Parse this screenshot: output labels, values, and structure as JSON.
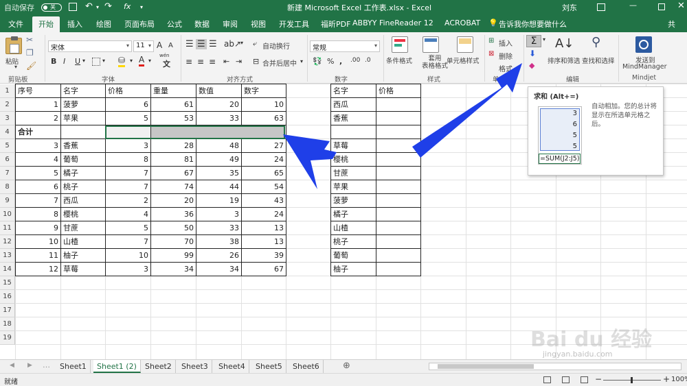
{
  "titlebar": {
    "autosave_label": "自动保存",
    "autosave_state": "关",
    "save_icon": "save-icon",
    "undo_icon": "undo-icon",
    "redo_icon": "redo-icon",
    "fx_label": "fx",
    "title": "新建 Microsoft Excel 工作表.xlsx  -  Excel",
    "user": "刘东",
    "accent": "#217346"
  },
  "tabs": [
    "文件",
    "开始",
    "插入",
    "绘图",
    "页面布局",
    "公式",
    "数据",
    "审阅",
    "视图",
    "开发工具",
    "福昕PDF",
    "ABBYY FineReader 12",
    "ACROBAT"
  ],
  "active_tab": "开始",
  "tell_me": "告诉我你想要做什么",
  "share": "共",
  "ribbon": {
    "paste": "粘贴",
    "clipboard_group": "剪贴板",
    "font_name": "宋体",
    "font_size": "11",
    "bold": "B",
    "italic": "I",
    "underline": "U",
    "font_grow": "A",
    "font_shrink": "A",
    "wen": "wén",
    "font_group": "字体",
    "wrap": "自动换行",
    "merge": "合并后居中",
    "align_group": "对齐方式",
    "number_format": "常规",
    "number_group": "数字",
    "conditional": "条件格式",
    "table_format": "套用\n表格格式",
    "cell_style": "单元格样式",
    "style_group": "样式",
    "insert": "插入",
    "delete": "删除",
    "format": "格式",
    "cells_group": "单元格",
    "autosum": "Σ",
    "sort_filter": "排序和筛选",
    "find_select": "查找和选择",
    "edit_group": "编辑",
    "send_to": "发送到",
    "mindmanager": "MindManager",
    "mindjet_group": "Mindjet"
  },
  "sheet": {
    "header_row": [
      "序号",
      "名字",
      "价格",
      "重量",
      "数值",
      "数字"
    ],
    "rows": [
      [
        "1",
        "菠萝",
        "6",
        "61",
        "20",
        "10"
      ],
      [
        "2",
        "苹果",
        "5",
        "53",
        "33",
        "63"
      ],
      [
        "",
        "",
        "",
        "",
        "",
        ""
      ],
      [
        "3",
        "香蕉",
        "3",
        "28",
        "48",
        "27"
      ],
      [
        "4",
        "葡萄",
        "8",
        "81",
        "49",
        "24"
      ],
      [
        "5",
        "橘子",
        "7",
        "67",
        "35",
        "65"
      ],
      [
        "6",
        "桃子",
        "7",
        "74",
        "44",
        "54"
      ],
      [
        "7",
        "西瓜",
        "2",
        "20",
        "19",
        "43"
      ],
      [
        "8",
        "樱桃",
        "4",
        "36",
        "3",
        "24"
      ],
      [
        "9",
        "甘蔗",
        "5",
        "50",
        "33",
        "13"
      ],
      [
        "10",
        "山楂",
        "7",
        "70",
        "38",
        "13"
      ],
      [
        "11",
        "柚子",
        "10",
        "99",
        "26",
        "39"
      ],
      [
        "12",
        "草莓",
        "3",
        "34",
        "34",
        "67"
      ]
    ],
    "total_label": "合计",
    "side_header": [
      "名字",
      "价格"
    ],
    "side_names": [
      "西瓜",
      "香蕉",
      "",
      "草莓",
      "樱桃",
      "甘蔗",
      "苹果",
      "菠萝",
      "橘子",
      "山楂",
      "桃子",
      "葡萄",
      "柚子"
    ],
    "row_numbers": [
      "1",
      "2",
      "3",
      "4",
      "5",
      "6",
      "7",
      "8",
      "9",
      "10",
      "11",
      "12",
      "13",
      "14",
      "15",
      "16",
      "17",
      "18",
      "19"
    ]
  },
  "tooltip": {
    "title": "求和 (Alt+=)",
    "desc": "自动相加。您的总计将显示在所选单元格之后。",
    "sample_values": [
      "3",
      "6",
      "5",
      "5"
    ],
    "formula": "=SUM(J2:J5)"
  },
  "sheet_tabs": [
    "Sheet1",
    "Sheet1 (2)",
    "Sheet2",
    "Sheet3",
    "Sheet4",
    "Sheet5",
    "Sheet6"
  ],
  "active_sheet": "Sheet1 (2)",
  "status": {
    "ready": "就绪",
    "zoom": "100%"
  },
  "watermark": {
    "logo": "Bai du 经验",
    "url": "jingyan.baidu.com"
  },
  "colors": {
    "excel_green": "#217346",
    "arrow_blue": "#1f3fe8",
    "selection_gray": "#c6c6c6"
  }
}
